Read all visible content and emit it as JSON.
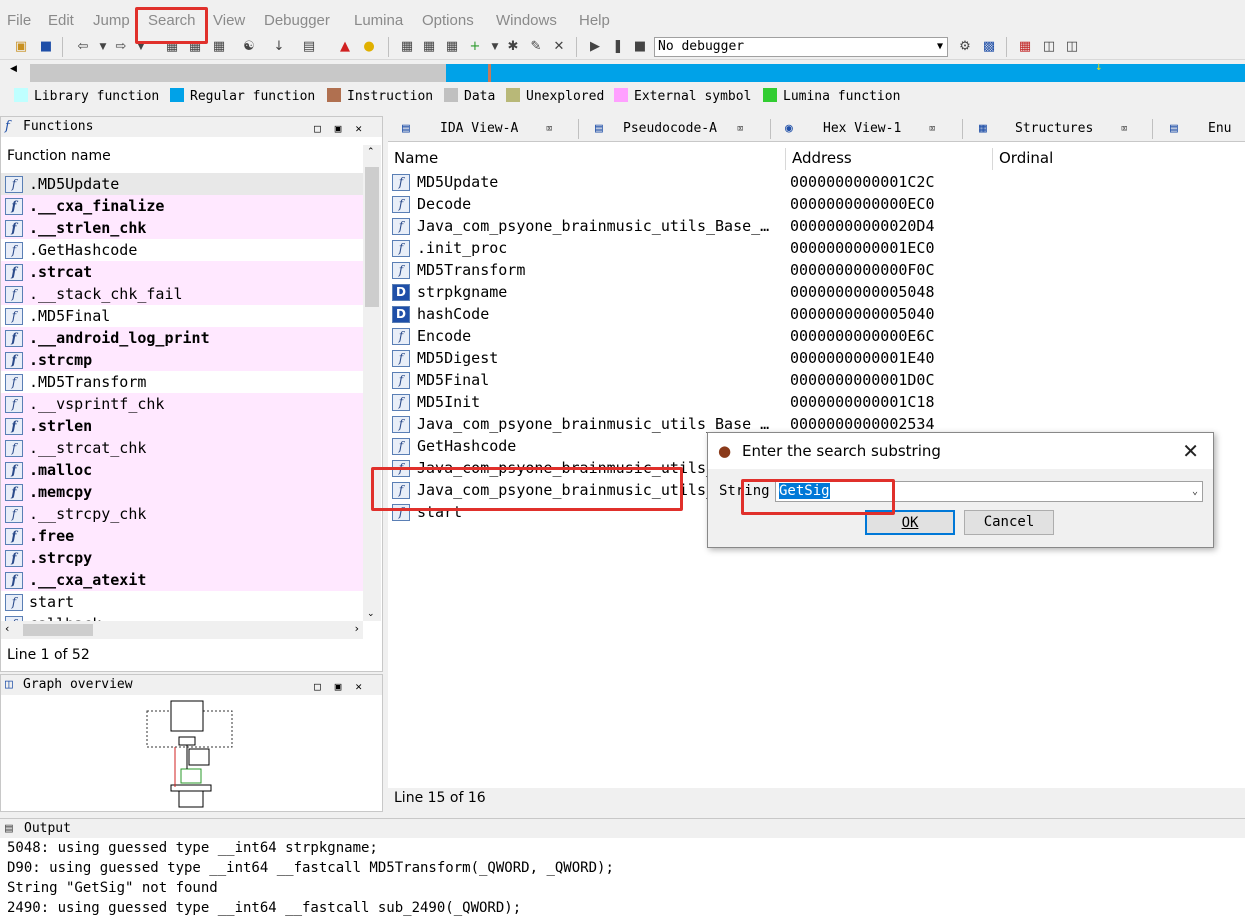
{
  "menu": [
    "File",
    "Edit",
    "Jump",
    "Search",
    "View",
    "Debugger",
    "Lumina",
    "Options",
    "Windows",
    "Help"
  ],
  "toolbar": {
    "debugger_value": "No debugger"
  },
  "legend": [
    {
      "label": "Library function",
      "color": "#bfffff"
    },
    {
      "label": "Regular function",
      "color": "#00a2e8"
    },
    {
      "label": "Instruction",
      "color": "#b07050"
    },
    {
      "label": "Data",
      "color": "#c0c0c0"
    },
    {
      "label": "Unexplored",
      "color": "#b8b878"
    },
    {
      "label": "External symbol",
      "color": "#ffa0ff"
    },
    {
      "label": "Lumina function",
      "color": "#32cd32"
    }
  ],
  "functions_panel": {
    "title": "Functions",
    "column_header": "Function name",
    "rows": [
      {
        "name": ".MD5Update",
        "style": "sel"
      },
      {
        "name": ".__cxa_finalize",
        "style": "pink-bold"
      },
      {
        "name": ".__strlen_chk",
        "style": "pink-bold"
      },
      {
        "name": ".GetHashcode",
        "style": "plain"
      },
      {
        "name": ".strcat",
        "style": "pink-bold"
      },
      {
        "name": ".__stack_chk_fail",
        "style": "pink"
      },
      {
        "name": ".MD5Final",
        "style": "plain"
      },
      {
        "name": ".__android_log_print",
        "style": "pink-bold"
      },
      {
        "name": ".strcmp",
        "style": "pink-bold"
      },
      {
        "name": ".MD5Transform",
        "style": "plain"
      },
      {
        "name": ".__vsprintf_chk",
        "style": "pink"
      },
      {
        "name": ".strlen",
        "style": "pink-bold"
      },
      {
        "name": ".__strcat_chk",
        "style": "pink"
      },
      {
        "name": ".malloc",
        "style": "pink-bold"
      },
      {
        "name": ".memcpy",
        "style": "pink-bold"
      },
      {
        "name": ".__strcpy_chk",
        "style": "pink"
      },
      {
        "name": ".free",
        "style": "pink-bold"
      },
      {
        "name": ".strcpy",
        "style": "pink-bold"
      },
      {
        "name": ".__cxa_atexit",
        "style": "pink-bold"
      },
      {
        "name": "start",
        "style": "plain"
      },
      {
        "name": "callback",
        "style": "plain"
      }
    ],
    "status": "Line 1 of 52"
  },
  "graph_panel": {
    "title": "Graph overview"
  },
  "tabs": [
    {
      "label": "IDA View-A",
      "icon": "ida-view-icon"
    },
    {
      "label": "Pseudocode-A",
      "icon": "pseudocode-icon"
    },
    {
      "label": "Hex View-1",
      "icon": "hex-view-icon"
    },
    {
      "label": "Structures",
      "icon": "structures-icon"
    },
    {
      "label": "Enu",
      "icon": "enums-icon"
    }
  ],
  "main": {
    "columns": [
      "Name",
      "Address",
      "Ordinal"
    ],
    "rows": [
      {
        "name": "MD5Update",
        "address": "0000000000001C2C",
        "type": "f"
      },
      {
        "name": "Decode",
        "address": "0000000000000EC0",
        "type": "f"
      },
      {
        "name": "Java_com_psyone_brainmusic_utils_Base_…",
        "address": "00000000000020D4",
        "type": "f"
      },
      {
        "name": ".init_proc",
        "address": "0000000000001EC0",
        "type": "f"
      },
      {
        "name": "MD5Transform",
        "address": "0000000000000F0C",
        "type": "f"
      },
      {
        "name": "strpkgname",
        "address": "0000000000005048",
        "type": "D"
      },
      {
        "name": "hashCode",
        "address": "0000000000005040",
        "type": "D"
      },
      {
        "name": "Encode",
        "address": "0000000000000E6C",
        "type": "f"
      },
      {
        "name": "MD5Digest",
        "address": "0000000000001E40",
        "type": "f"
      },
      {
        "name": "MD5Final",
        "address": "0000000000001D0C",
        "type": "f"
      },
      {
        "name": "MD5Init",
        "address": "0000000000001C18",
        "type": "f"
      },
      {
        "name": "Java_com_psyone_brainmusic_utils_Base_…",
        "address": "0000000000002534",
        "type": "f"
      },
      {
        "name": "GetHashcode",
        "address": "",
        "type": "f"
      },
      {
        "name": "Java_com_psyone_brainmusic_utils_",
        "address": "",
        "type": "f"
      },
      {
        "name": "Java_com_psyone_brainmusic_utils_",
        "address": "",
        "type": "f"
      },
      {
        "name": "start",
        "address": "",
        "type": "f"
      }
    ],
    "status": "Line 15 of 16"
  },
  "output": {
    "title": "Output",
    "lines": [
      "5048: using guessed type __int64 strpkgname;",
      "D90: using guessed type __int64 __fastcall MD5Transform(_QWORD, _QWORD);",
      "String \"GetSig\" not found",
      "2490: using guessed type __int64 __fastcall sub_2490(_QWORD);"
    ]
  },
  "dialog": {
    "title": "Enter the search substring",
    "label": "String",
    "value": "GetSig",
    "ok": "OK",
    "cancel": "Cancel"
  }
}
